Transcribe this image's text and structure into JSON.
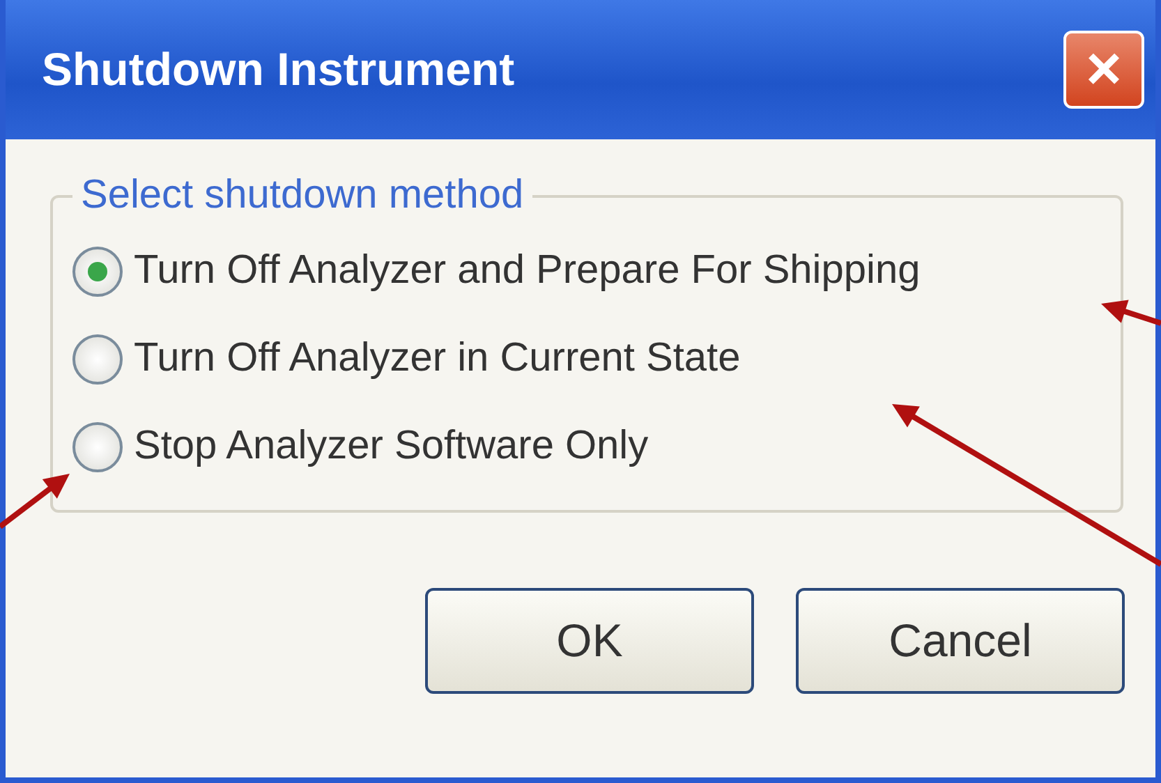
{
  "window": {
    "title": "Shutdown Instrument",
    "close": "×"
  },
  "group": {
    "label": "Select shutdown method",
    "options": [
      {
        "label": "Turn Off Analyzer and Prepare For Shipping",
        "selected": true
      },
      {
        "label": "Turn Off Analyzer in Current State",
        "selected": false
      },
      {
        "label": "Stop Analyzer Software Only",
        "selected": false
      }
    ]
  },
  "buttons": [
    "OK",
    "Cancel"
  ]
}
